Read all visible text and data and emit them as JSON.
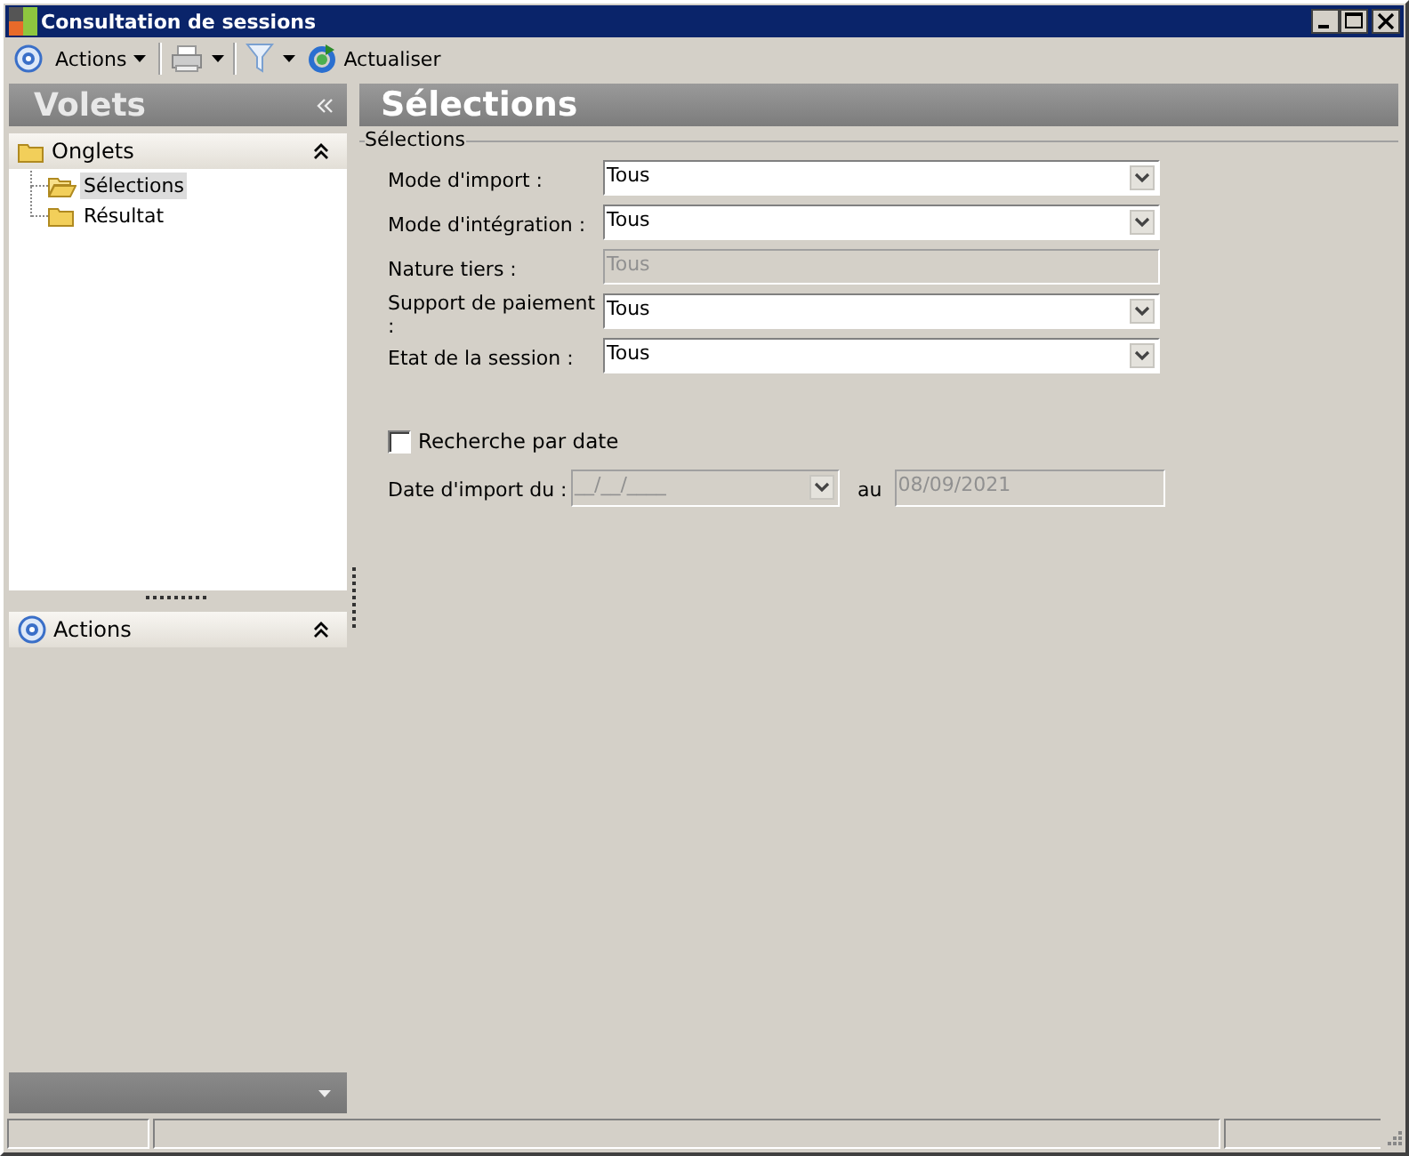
{
  "window": {
    "title": "Consultation de sessions"
  },
  "toolbar": [
    {
      "kind": "menu",
      "label": "Actions"
    },
    {
      "kind": "print"
    },
    {
      "kind": "filter"
    },
    {
      "kind": "refresh",
      "label": "Actualiser"
    }
  ],
  "sidebar": {
    "title": "Volets",
    "groups": [
      {
        "kind": "tree",
        "title": "Onglets",
        "items": [
          {
            "label": "Sélections",
            "selected": true
          },
          {
            "label": "Résultat",
            "selected": false
          }
        ]
      },
      {
        "kind": "actions",
        "title": "Actions"
      }
    ]
  },
  "panel": {
    "title": "Sélections",
    "group_title": "Sélections",
    "fields": [
      {
        "label": "Mode d'import :",
        "value": "Tous",
        "kind": "combo",
        "disabled": false
      },
      {
        "label": "Mode d'intégration :",
        "value": "Tous",
        "kind": "combo",
        "disabled": false
      },
      {
        "label": "Nature tiers :",
        "value": "Tous",
        "kind": "text",
        "disabled": true
      },
      {
        "label": "Support de paiement :",
        "value": "Tous",
        "kind": "combo",
        "disabled": false
      },
      {
        "label": "Etat de la session :",
        "value": "Tous",
        "kind": "combo",
        "disabled": false
      }
    ],
    "date_search": {
      "label": "Recherche par date",
      "checked": false
    },
    "date_range": {
      "label": "Date d'import du :",
      "from": "__/__/____",
      "to_label": "au",
      "to": "08/09/2021",
      "disabled": true
    }
  }
}
